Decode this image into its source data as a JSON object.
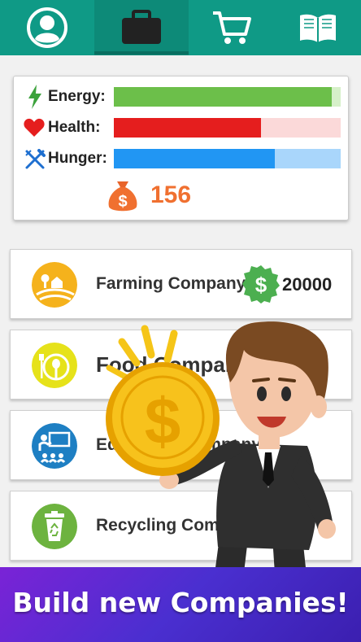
{
  "tabs": [
    {
      "id": "profile",
      "icon": "user-avatar-icon"
    },
    {
      "id": "companies",
      "icon": "briefcase-icon",
      "active": true
    },
    {
      "id": "shop",
      "icon": "shopping-cart-icon"
    },
    {
      "id": "guide",
      "icon": "book-icon"
    }
  ],
  "stats": {
    "energy": {
      "label": "Energy:",
      "level": 0.96,
      "color": "#6cbf4a",
      "track": "#d6f0c9",
      "icon": "lightning-icon"
    },
    "health": {
      "label": "Health:",
      "level": 0.65,
      "color": "#e51e1e",
      "track": "#fbd9d9",
      "icon": "heart-icon"
    },
    "hunger": {
      "label": "Hunger:",
      "level": 0.71,
      "color": "#2196f3",
      "track": "#a9d6fb",
      "icon": "fork-knife-icon"
    }
  },
  "money": {
    "value": "156",
    "icon": "money-bag-icon",
    "color": "#f07030"
  },
  "companies": [
    {
      "name": "Farming Company",
      "price": "20000",
      "icon": "farm-icon"
    },
    {
      "name": "Food Company",
      "icon": "food-plate-icon"
    },
    {
      "name": "Education Company",
      "icon": "classroom-icon"
    },
    {
      "name": "Recycling Company",
      "icon": "recycle-bin-icon"
    }
  ],
  "banner": {
    "text": "Build new Companies!"
  }
}
